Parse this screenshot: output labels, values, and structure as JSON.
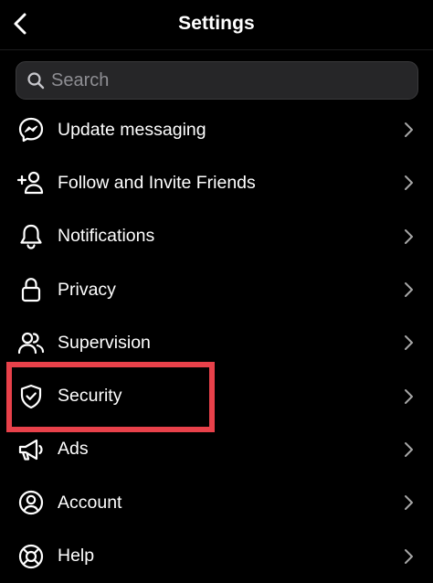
{
  "header": {
    "title": "Settings",
    "back_icon": "chevron-left-icon"
  },
  "search": {
    "placeholder": "Search",
    "value": "",
    "icon": "search-icon"
  },
  "menu": {
    "items": [
      {
        "label": "Update messaging",
        "icon": "messenger-icon"
      },
      {
        "label": "Follow and Invite Friends",
        "icon": "add-person-icon"
      },
      {
        "label": "Notifications",
        "icon": "bell-icon"
      },
      {
        "label": "Privacy",
        "icon": "lock-icon"
      },
      {
        "label": "Supervision",
        "icon": "people-icon"
      },
      {
        "label": "Security",
        "icon": "shield-check-icon"
      },
      {
        "label": "Ads",
        "icon": "megaphone-icon"
      },
      {
        "label": "Account",
        "icon": "account-circle-icon"
      },
      {
        "label": "Help",
        "icon": "lifebuoy-icon"
      }
    ],
    "chevron_icon": "chevron-right-icon"
  },
  "annotation": {
    "highlighted_item": "Security",
    "color": "#e8414a"
  },
  "colors": {
    "background": "#000000",
    "text": "#ffffff",
    "search_bg": "#262628",
    "placeholder": "#8e8e93",
    "chevron": "#a6a6a6"
  }
}
